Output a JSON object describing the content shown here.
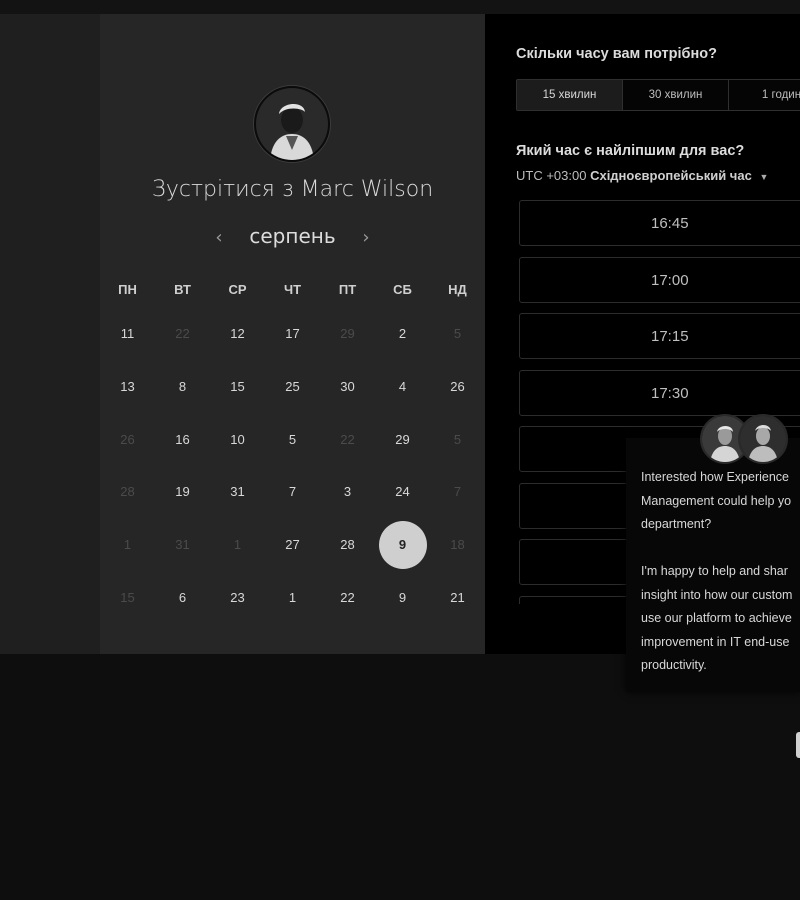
{
  "scheduler": {
    "title": "Зустрітися з Marc Wilson",
    "month": "серпень",
    "prev_icon": "‹",
    "next_icon": "›",
    "weekdays": [
      "ПН",
      "ВТ",
      "СР",
      "ЧТ",
      "ПТ",
      "СБ",
      "НД"
    ],
    "weeks": [
      [
        {
          "d": "11",
          "m": false
        },
        {
          "d": "22",
          "m": true
        },
        {
          "d": "12",
          "m": false
        },
        {
          "d": "17",
          "m": false
        },
        {
          "d": "29",
          "m": true
        },
        {
          "d": "2",
          "m": false
        },
        {
          "d": "5",
          "m": true
        }
      ],
      [
        {
          "d": "13",
          "m": false
        },
        {
          "d": "8",
          "m": false
        },
        {
          "d": "15",
          "m": false
        },
        {
          "d": "25",
          "m": false
        },
        {
          "d": "30",
          "m": false
        },
        {
          "d": "4",
          "m": false
        },
        {
          "d": "26",
          "m": false
        }
      ],
      [
        {
          "d": "26",
          "m": true
        },
        {
          "d": "16",
          "m": false
        },
        {
          "d": "10",
          "m": false
        },
        {
          "d": "5",
          "m": false
        },
        {
          "d": "22",
          "m": true
        },
        {
          "d": "29",
          "m": false
        },
        {
          "d": "5",
          "m": true
        }
      ],
      [
        {
          "d": "28",
          "m": true
        },
        {
          "d": "19",
          "m": false
        },
        {
          "d": "31",
          "m": false
        },
        {
          "d": "7",
          "m": false
        },
        {
          "d": "3",
          "m": false
        },
        {
          "d": "24",
          "m": false
        },
        {
          "d": "7",
          "m": true
        }
      ],
      [
        {
          "d": "1",
          "m": true
        },
        {
          "d": "31",
          "m": true
        },
        {
          "d": "1",
          "m": true
        },
        {
          "d": "27",
          "m": false
        },
        {
          "d": "28",
          "m": false
        },
        {
          "d": "9",
          "m": false,
          "selected": true
        },
        {
          "d": "18",
          "m": true
        }
      ],
      [
        {
          "d": "15",
          "m": true
        },
        {
          "d": "6",
          "m": false
        },
        {
          "d": "23",
          "m": false
        },
        {
          "d": "1",
          "m": false
        },
        {
          "d": "22",
          "m": false
        },
        {
          "d": "9",
          "m": false
        },
        {
          "d": "21",
          "m": false
        }
      ]
    ]
  },
  "booking": {
    "duration_question": "Скільки часу вам потрібно?",
    "durations": [
      "15 хвилин",
      "30 хвилин",
      "1 годин"
    ],
    "active_duration_index": 0,
    "time_question": "Який час є найліпшим для вас?",
    "tz_offset": "UTC +03:00",
    "tz_name": "Східноєвропейський час",
    "slots": [
      "16:45",
      "17:00",
      "17:15",
      "17:30",
      "",
      "",
      "",
      ""
    ]
  },
  "chat": {
    "lines": "Interested how Experience\nManagement could help yo\ndepartment?\n\nI'm happy to help and shar\ninsight into how our custom\nuse our platform to achieve\nimprovement in IT end-use\nproductivity."
  },
  "colors": {
    "selected_day_bg": "#cfcfcf",
    "card_bg": "#262626",
    "panel_bg": "#000000"
  }
}
